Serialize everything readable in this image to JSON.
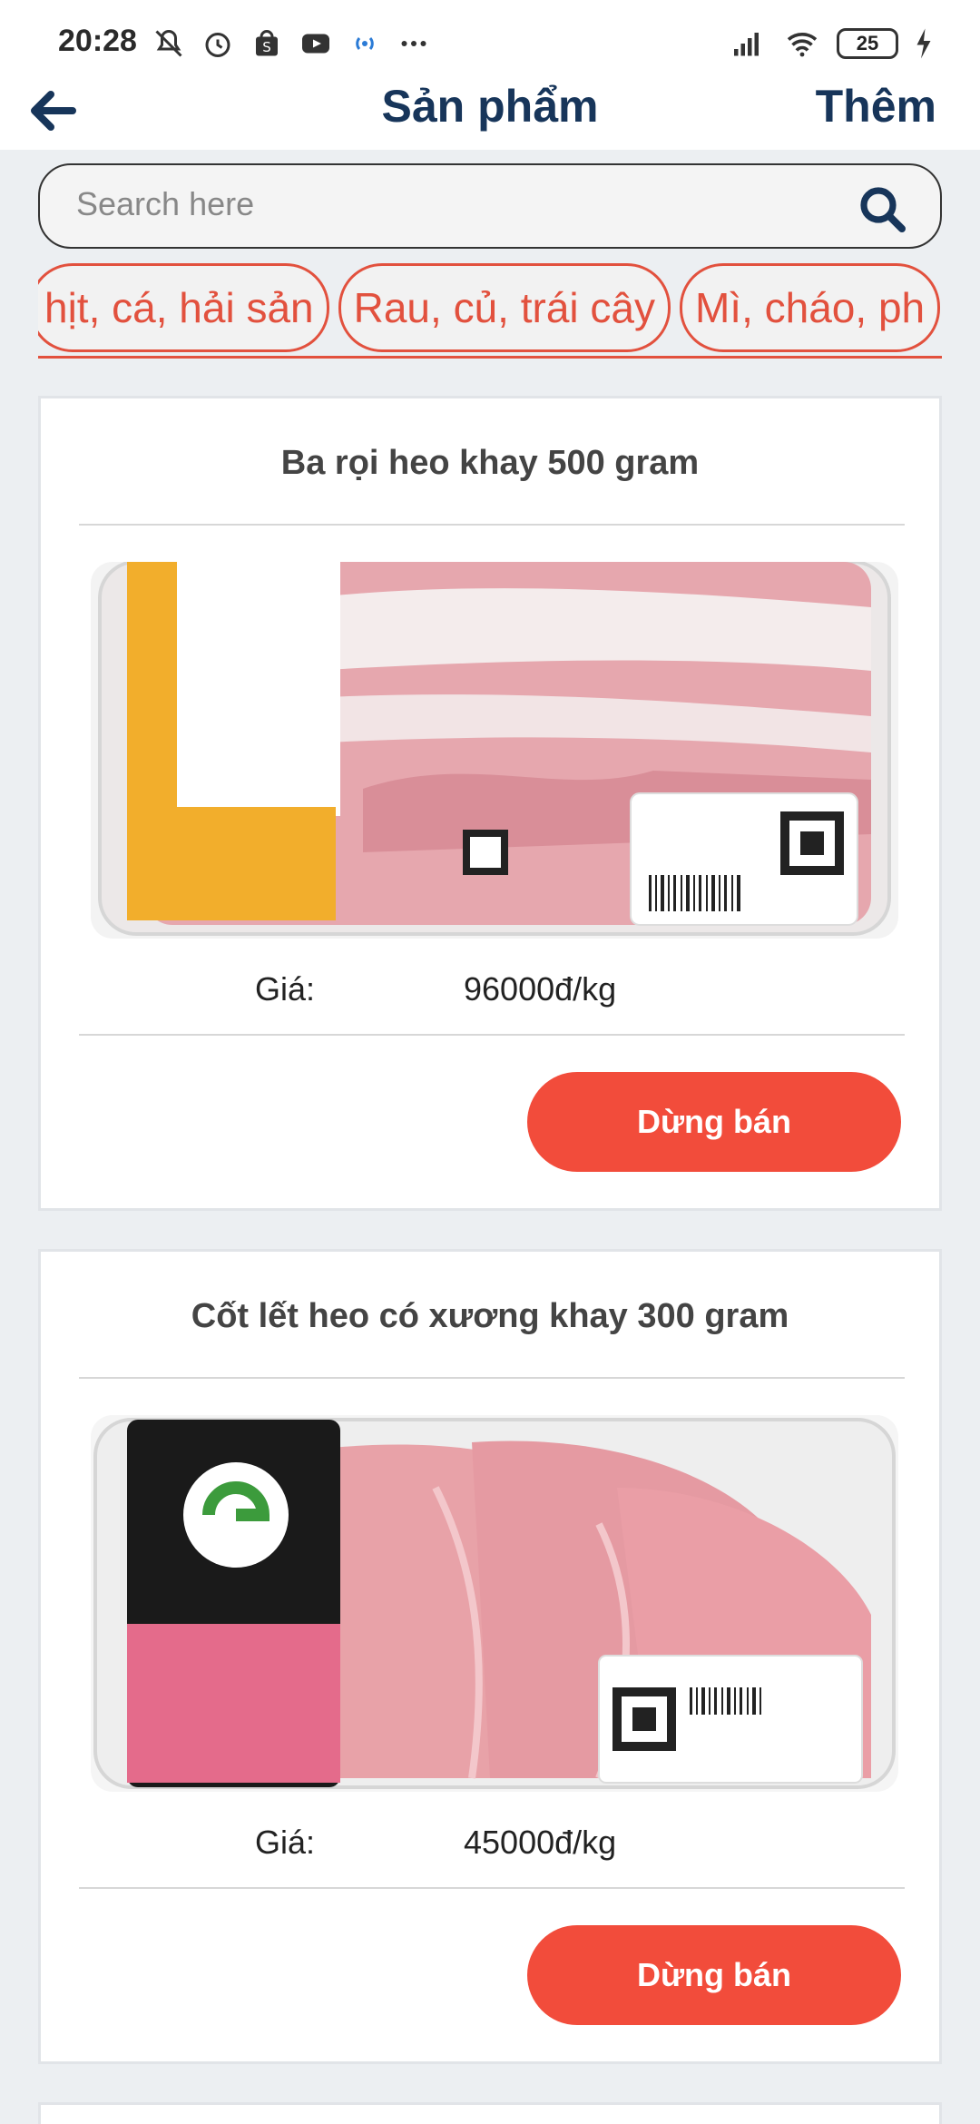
{
  "status_bar": {
    "time": "20:28",
    "battery": "25",
    "icons": [
      "muted-bell-icon",
      "alarm-icon",
      "shopee-icon",
      "youtube-icon",
      "hotspot-icon",
      "more-dots-icon",
      "signal-icon",
      "wifi-icon",
      "battery-icon",
      "charging-icon"
    ]
  },
  "header": {
    "back_icon": "arrow-left-icon",
    "title": "Sản phẩm",
    "add_label": "Thêm"
  },
  "search": {
    "placeholder": "Search here",
    "icon": "search-icon"
  },
  "categories": [
    {
      "label": "hịt, cá, hải sản"
    },
    {
      "label": "Rau, củ, trái cây"
    },
    {
      "label": "Mì, cháo, ph"
    }
  ],
  "products": [
    {
      "name": "Ba rọi heo khay 500 gram",
      "price_label": "Giá:",
      "price": "96000đ/kg",
      "action_label": "Dừng bán"
    },
    {
      "name": "Cốt lết heo có xương khay 300 gram",
      "price_label": "Giá:",
      "price": "45000đ/kg",
      "action_label": "Dừng bán"
    }
  ],
  "colors": {
    "accent": "#f24c3b",
    "title_navy": "#17355a",
    "chip_red": "#e2513e"
  }
}
